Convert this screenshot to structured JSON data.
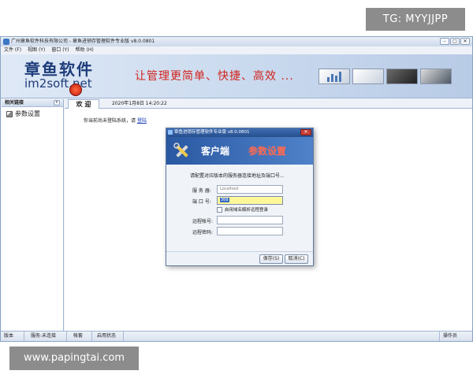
{
  "overlays": {
    "tg_label": "TG: MYYJJPP",
    "site_label": "www.papingtai.com"
  },
  "window": {
    "title": "广州章鱼软件科技有限公司 - 章鱼进销存管理软件专业版 v8.0.0801",
    "controls": [
      "minimize",
      "maximize",
      "close"
    ]
  },
  "menu": [
    "文件 (F)",
    "视图 (Y)",
    "窗口 (Y)",
    "帮助 (H)"
  ],
  "banner": {
    "logo_cn": "章鱼软件",
    "logo_en": "im2soft.net",
    "slogan": "让管理更简单、快捷、高效 ..."
  },
  "sidebar": {
    "header": "相关链接",
    "collapse_label": "«",
    "items": [
      {
        "label": "参数设置",
        "icon": "gear-icon"
      }
    ]
  },
  "main": {
    "tab_label": "欢 迎",
    "datetime": "2020年1月8日  14:20:22",
    "notice_prefix": "你当前尚未登陆系统，请",
    "notice_link": "登陆"
  },
  "dialog": {
    "title": "章鱼进销存管理软件专业版 v8.0.0801",
    "close_label": "✕",
    "header_client": "客户端",
    "header_params": "参数设置",
    "prompt": "请配置对应版本的服务器连接地址及端口号...",
    "fields": {
      "server_label": "服 务 器:",
      "server_value": "Localhost",
      "port_label": "端 口 号:",
      "port_value": "368",
      "remote_checkbox_label": "启用域名解析远程登录",
      "remote_account_label": "远程帐号:",
      "remote_account_value": "",
      "remote_password_label": "远程密码:",
      "remote_password_value": ""
    },
    "buttons": {
      "save": "保存(S)",
      "cancel": "取消(C)"
    }
  },
  "statusbar": {
    "version_label": "版本",
    "service_status": "服务:未连接",
    "set_label": "帐套",
    "enable_status": "启用状态",
    "operator_label": "操作员"
  },
  "colors": {
    "accent": "#264f8e",
    "slogan": "#d2231c",
    "highlight_field": "#fff89a"
  }
}
